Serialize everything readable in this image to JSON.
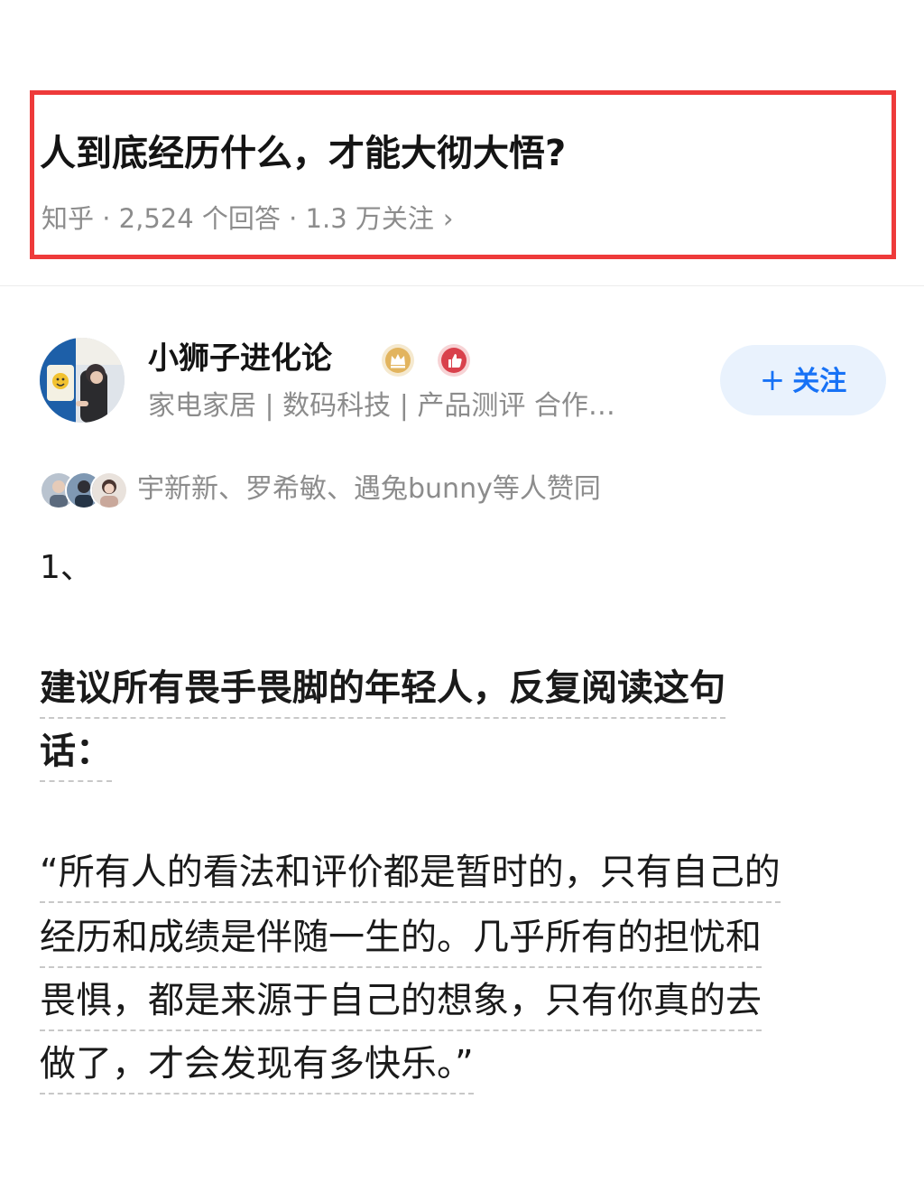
{
  "question": {
    "title": "人到底经历什么，才能大彻大悟?",
    "meta": "知乎 · 2,524 个回答 · 1.3 万关注",
    "chevron": "›"
  },
  "author": {
    "name": "小狮子进化论",
    "bio": "家电家居 | 数码科技 | 产品测评 合作…",
    "follow_label": "关注",
    "follow_plus": "+"
  },
  "upvoters": {
    "text": "宇新新、罗希敏、遇兔bunny等人赞同"
  },
  "answer": {
    "number": "1、",
    "heading_lines": [
      "建议所有畏手畏脚的年轻人，反复阅读这句",
      "话："
    ],
    "quote_lines": [
      "“所有人的看法和评价都是暂时的，只有自己的",
      "经历和成绩是伴随一生的。几乎所有的担忧和",
      "畏惧，都是来源于自己的想象，只有你真的去",
      "做了，才会发现有多快乐。”"
    ]
  },
  "colors": {
    "highlight_border": "#ee3a3a",
    "follow_text": "#1772f6",
    "follow_bg": "#e9f2fd",
    "meta_text": "#8c8c8c"
  }
}
